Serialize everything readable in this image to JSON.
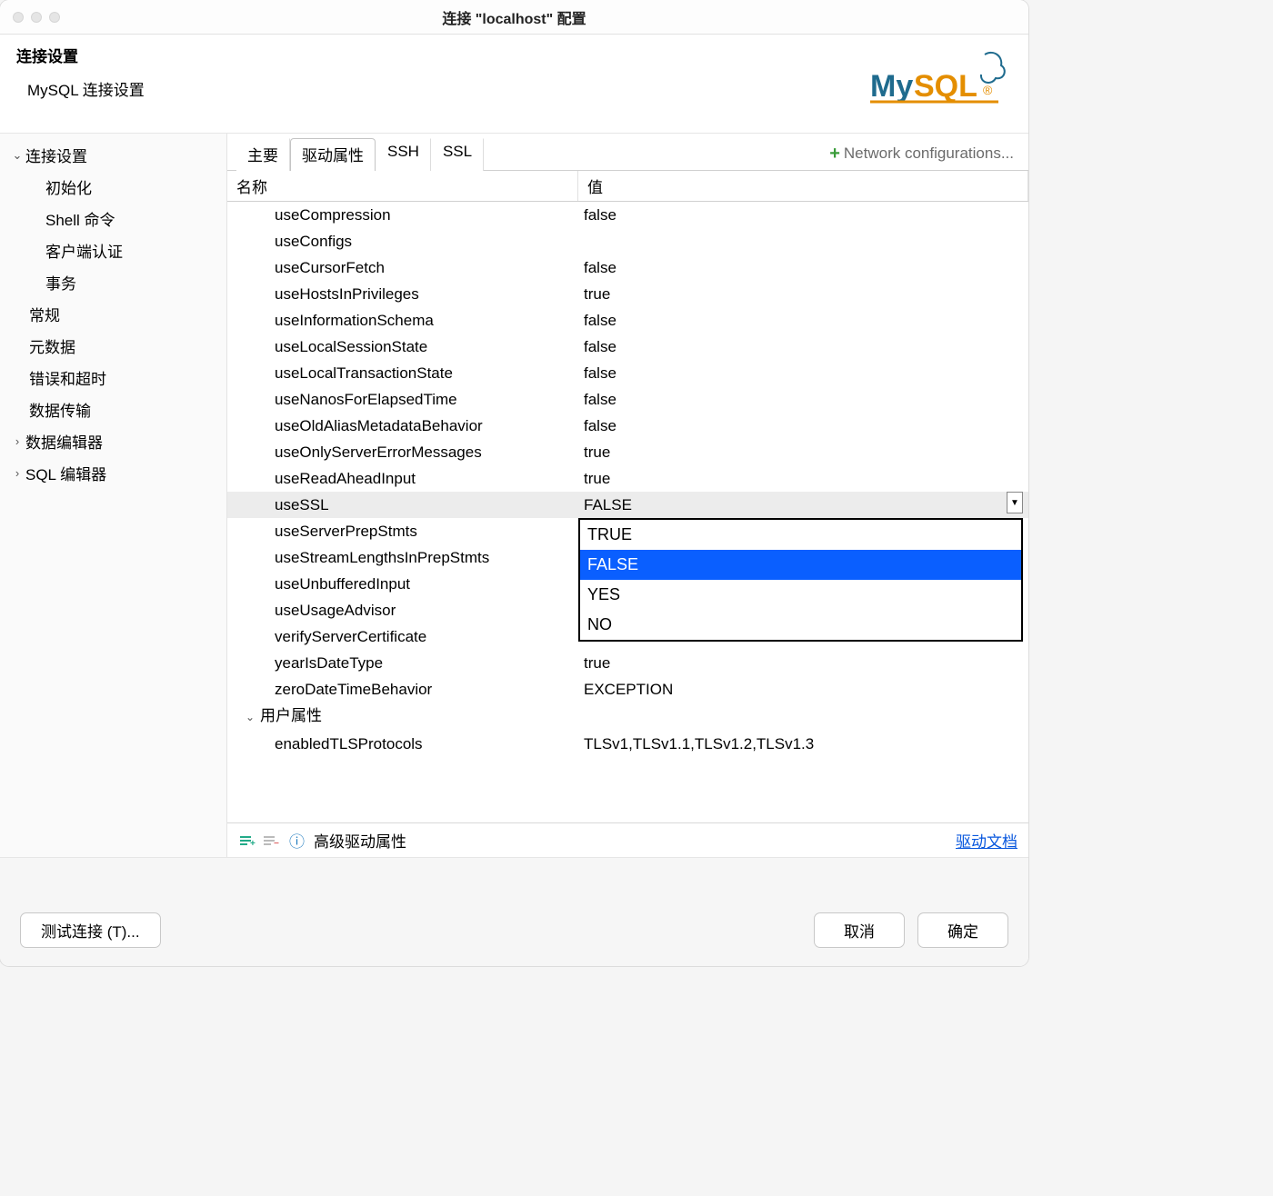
{
  "window": {
    "title": "连接 \"localhost\" 配置"
  },
  "header": {
    "title": "连接设置",
    "subtitle": "MySQL 连接设置"
  },
  "sidebar": {
    "items": [
      {
        "label": "连接设置",
        "expandable": true,
        "expanded": true,
        "children": [
          {
            "label": "初始化"
          },
          {
            "label": "Shell 命令"
          },
          {
            "label": "客户端认证"
          },
          {
            "label": "事务"
          }
        ]
      },
      {
        "label": "常规"
      },
      {
        "label": "元数据"
      },
      {
        "label": "错误和超时"
      },
      {
        "label": "数据传输"
      },
      {
        "label": "数据编辑器",
        "expandable": true,
        "expanded": false
      },
      {
        "label": "SQL 编辑器",
        "expandable": true,
        "expanded": false
      }
    ]
  },
  "tabs": {
    "items": [
      "主要",
      "驱动属性",
      "SSH",
      "SSL"
    ],
    "active": 1,
    "network_config": "Network configurations..."
  },
  "table": {
    "head_name": "名称",
    "head_value": "值",
    "rows": [
      {
        "name": "useCompression",
        "value": "false"
      },
      {
        "name": "useConfigs",
        "value": ""
      },
      {
        "name": "useCursorFetch",
        "value": "false"
      },
      {
        "name": "useHostsInPrivileges",
        "value": "true"
      },
      {
        "name": "useInformationSchema",
        "value": "false"
      },
      {
        "name": "useLocalSessionState",
        "value": "false"
      },
      {
        "name": "useLocalTransactionState",
        "value": "false"
      },
      {
        "name": "useNanosForElapsedTime",
        "value": "false"
      },
      {
        "name": "useOldAliasMetadataBehavior",
        "value": "false"
      },
      {
        "name": "useOnlyServerErrorMessages",
        "value": "true"
      },
      {
        "name": "useReadAheadInput",
        "value": "true"
      },
      {
        "name": "useSSL",
        "value": "FALSE",
        "selected": true,
        "dropdown": true
      },
      {
        "name": "useServerPrepStmts",
        "value": ""
      },
      {
        "name": "useStreamLengthsInPrepStmts",
        "value": ""
      },
      {
        "name": "useUnbufferedInput",
        "value": ""
      },
      {
        "name": "useUsageAdvisor",
        "value": ""
      },
      {
        "name": "verifyServerCertificate",
        "value": ""
      },
      {
        "name": "yearIsDateType",
        "value": "true"
      },
      {
        "name": "zeroDateTimeBehavior",
        "value": "EXCEPTION"
      }
    ],
    "group_label": "用户属性",
    "group_row": {
      "name": "enabledTLSProtocols",
      "value": "TLSv1,TLSv1.1,TLSv1.2,TLSv1.3"
    },
    "dropdown_options": [
      "TRUE",
      "FALSE",
      "YES",
      "NO"
    ],
    "dropdown_selected": "FALSE"
  },
  "toolbar": {
    "label": "高级驱动属性",
    "link": "驱动文档"
  },
  "footer": {
    "test": "测试连接 (T)...",
    "cancel": "取消",
    "ok": "确定"
  }
}
